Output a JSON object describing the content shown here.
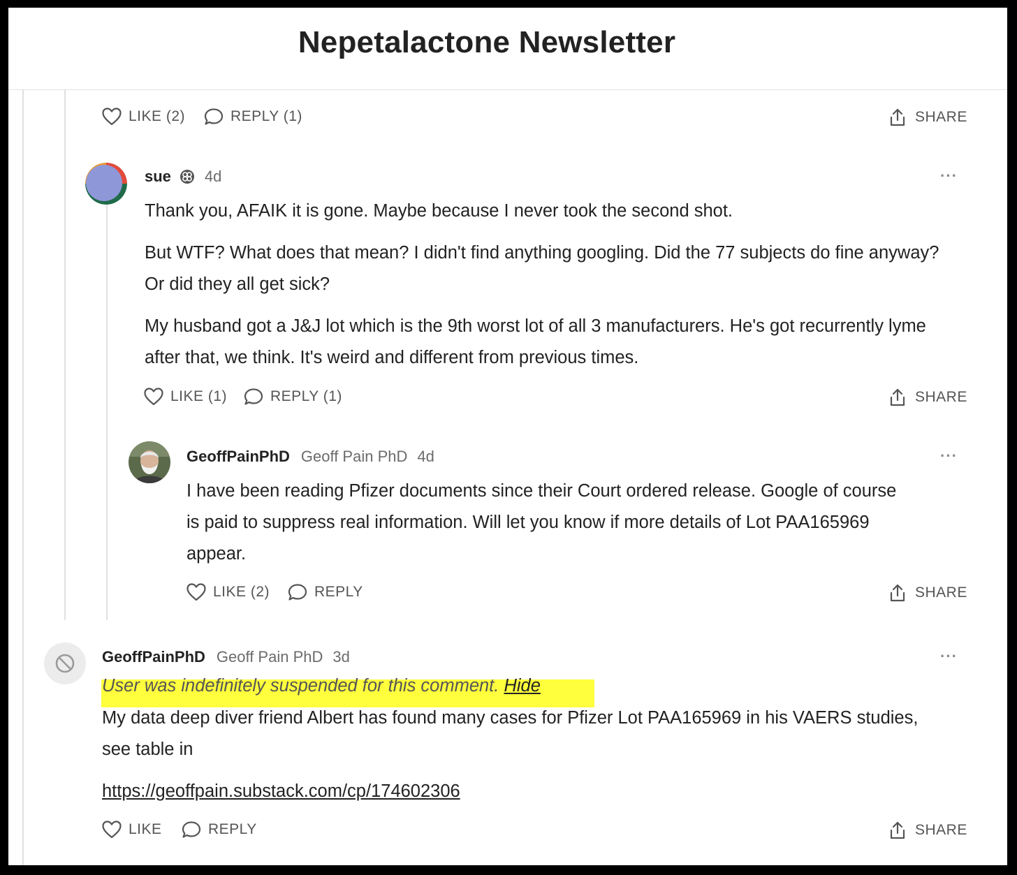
{
  "header": {
    "title": "Nepetalactone Newsletter"
  },
  "top_actions": {
    "like": "LIKE (2)",
    "reply": "REPLY (1)",
    "share": "SHARE"
  },
  "comments": [
    {
      "handle": "sue",
      "time": "4d",
      "paragraphs": [
        "Thank you, AFAIK it is gone. Maybe because I never took the second shot.",
        "But WTF? What does that mean? I didn't find anything googling. Did the 77 subjects do fine anyway? Or did they all get sick?",
        "My husband got a J&J lot which is the 9th worst lot of all 3 manufacturers. He's got recurrently lyme after that, we think. It's weird and different from previous times."
      ],
      "like": "LIKE (1)",
      "reply": "REPLY (1)",
      "share": "SHARE"
    },
    {
      "handle": "GeoffPainPhD",
      "display_name": "Geoff Pain PhD",
      "time": "4d",
      "paragraphs": [
        "I have been reading Pfizer documents since their Court ordered release. Google of course is paid to suppress real information. Will let you know if more details of Lot PAA165969 appear."
      ],
      "like": "LIKE (2)",
      "reply": "REPLY",
      "share": "SHARE"
    },
    {
      "handle": "GeoffPainPhD",
      "display_name": "Geoff Pain PhD",
      "time": "3d",
      "suspended_notice": "User was indefinitely suspended for this comment.",
      "hide_label": "Hide",
      "paragraphs": [
        "My data deep diver friend Albert has found many cases for Pfizer Lot PAA165969 in his VAERS studies, see table in"
      ],
      "link": "https://geoffpain.substack.com/cp/174602306",
      "like": "LIKE",
      "reply": "REPLY",
      "share": "SHARE"
    }
  ],
  "more_label": "···",
  "colors": {
    "highlight": "#ffff3d",
    "muted": "#6b6b6b",
    "text": "#222222",
    "thread": "#e0e0e0"
  },
  "icons": [
    "heart-icon",
    "speech-bubble-icon",
    "share-upload-icon",
    "ellipsis-icon",
    "banned-icon",
    "avatar-image"
  ]
}
